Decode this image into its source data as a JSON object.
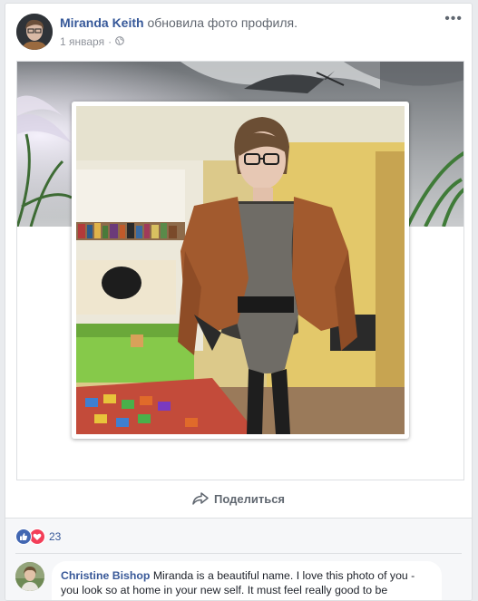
{
  "post": {
    "author": "Miranda Keith",
    "action": "обновила фото профиля.",
    "date": "1 января",
    "separator": "·",
    "privacy_icon": "globe-icon",
    "more_icon": "more-horizontal-icon"
  },
  "actions": {
    "share_label": "Поделиться",
    "share_icon": "share-arrow-icon"
  },
  "reactions": {
    "icons": [
      "like-icon",
      "love-icon"
    ],
    "count": "23"
  },
  "comment": {
    "author": "Christine Bishop",
    "text": "Miranda is a beautiful name. I love this photo of you - you look so at home in your new self. It must feel really good to be"
  },
  "colors": {
    "link": "#365899",
    "like": "#4267b2",
    "love": "#f33e58",
    "background": "#e9ebee"
  }
}
